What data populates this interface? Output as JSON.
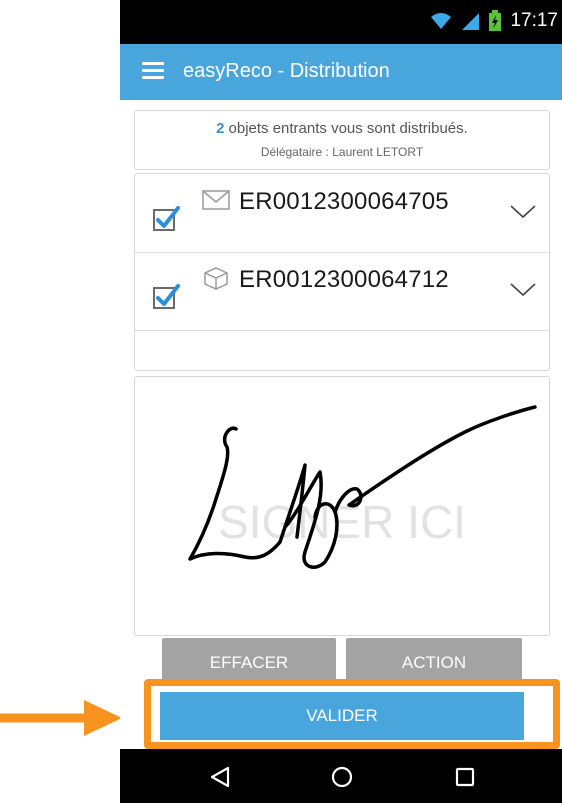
{
  "status_bar": {
    "time": "17:17"
  },
  "app_bar": {
    "title": "easyReco - Distribution",
    "color": "#49a6dc"
  },
  "summary": {
    "count": "2",
    "message": "objets entrants vous sont distribués.",
    "delegate_label": "Délégataire :",
    "delegate_name": "Laurent LETORT"
  },
  "items": [
    {
      "reference": "ER0012300064705",
      "type_icon": "envelope-icon",
      "checked": true
    },
    {
      "reference": "ER0012300064712",
      "type_icon": "package-icon",
      "checked": true
    }
  ],
  "signature": {
    "placeholder": "SIGNER ICI"
  },
  "buttons": {
    "clear_label": "EFFACER",
    "action_label": "ACTION",
    "validate_label": "VALIDER"
  },
  "colors": {
    "accent": "#49a6dc",
    "highlight": "#f7931e",
    "secondary_button": "#a3a3a3"
  }
}
